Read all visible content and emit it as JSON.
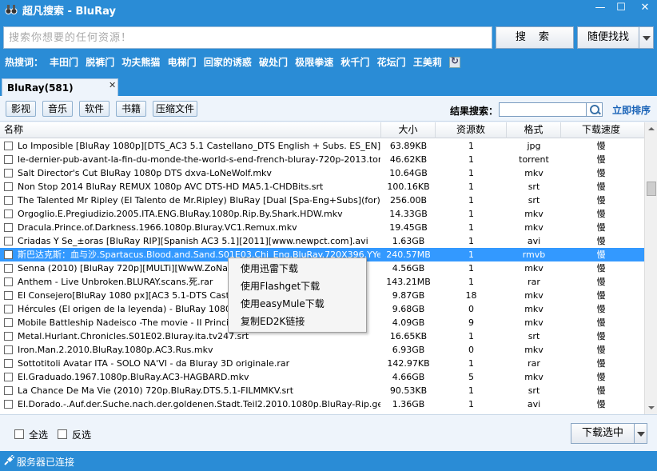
{
  "window": {
    "title": "超凡搜索 - BluRay"
  },
  "search": {
    "placeholder": "搜索你想要的任何资源！",
    "search_label": "搜 索",
    "random_label": "随便找找"
  },
  "hot": {
    "label": "热搜词：",
    "words": [
      "丰田门",
      "脱裤门",
      "功夫熊猫",
      "电梯门",
      "回家的诱惑",
      "破处门",
      "极限拳速",
      "秋千门",
      "花坛门",
      "王美莉"
    ]
  },
  "tab": {
    "label": "BluRay(581)",
    "close": "✕"
  },
  "categories": [
    "影视",
    "音乐",
    "软件",
    "书籍",
    "压缩文件"
  ],
  "filter": {
    "label": "结果搜索：",
    "sort_label": "立即排序"
  },
  "table": {
    "headers": {
      "name": "名称",
      "size": "大小",
      "sources": "资源数",
      "format": "格式",
      "speed": "下载速度"
    },
    "rows": [
      {
        "name": "Lo Imposible [BluRay 1080p][DTS_AC3 5.1 Castellano_DTS English + Subs. ES_EN][2013].m...",
        "size": "63.89KB",
        "sources": "1",
        "format": "jpg",
        "speed": "慢"
      },
      {
        "name": "le-dernier-pub-avant-la-fin-du-monde-the-world-s-end-french-bluray-720p-2013.torrent",
        "size": "46.62KB",
        "sources": "1",
        "format": "torrent",
        "speed": "慢"
      },
      {
        "name": "Salt Director's Cut BluRay 1080p DTS dxva-LoNeWolf.mkv",
        "size": "10.64GB",
        "sources": "1",
        "format": "mkv",
        "speed": "慢"
      },
      {
        "name": "Non Stop 2014 BluRay REMUX 1080p AVC DTS-HD MA5.1-CHDBits.srt",
        "size": "100.16KB",
        "sources": "1",
        "format": "srt",
        "speed": "慢"
      },
      {
        "name": "The Talented Mr Ripley (El Talento de Mr.Ripley) BluRay [Dual [Spa-Eng+Subs](for).srt",
        "size": "256.00B",
        "sources": "1",
        "format": "srt",
        "speed": "慢"
      },
      {
        "name": "Orgoglio.E.Pregiudizio.2005.ITA.ENG.BluRay.1080p.Rip.By.Shark.HDW.mkv",
        "size": "14.33GB",
        "sources": "1",
        "format": "mkv",
        "speed": "慢"
      },
      {
        "name": "Dracula.Prince.of.Darkness.1966.1080p.Bluray.VC1.Remux.mkv",
        "size": "19.45GB",
        "sources": "1",
        "format": "mkv",
        "speed": "慢"
      },
      {
        "name": "Criadas Y Se_±oras [BluRay RIP][Spanish AC3 5.1][2011][www.newpct.com].avi",
        "size": "1.63GB",
        "sources": "1",
        "format": "avi",
        "speed": "慢"
      },
      {
        "name": "斯巴达克斯：血与沙.Spartacus.Blood.and.Sand.S01E03.Chi_Eng.BluRay.720X396.YYeTs...",
        "size": "240.57MB",
        "sources": "1",
        "format": "rmvb",
        "speed": "慢"
      },
      {
        "name": "Senna (2010) [BluRay 720p][MULTi][WwW.ZoNaTe",
        "size": "4.56GB",
        "sources": "1",
        "format": "mkv",
        "speed": "慢"
      },
      {
        "name": "Anthem - Live Unbroken.BLURAY.scans.死.rar",
        "size": "143.21MB",
        "sources": "1",
        "format": "rar",
        "speed": "慢"
      },
      {
        "name": "El Consejero[BluRay 1080 px][AC3 5.1-DTS Castella",
        "size": "9.87GB",
        "sources": "18",
        "format": "mkv",
        "speed": "慢"
      },
      {
        "name": "Hércules (El origen de la leyenda) - BluRay 1080p.m",
        "size": "9.68GB",
        "sources": "0",
        "format": "mkv",
        "speed": "慢"
      },
      {
        "name": "Mobile Battleship Nadeisco -The movie - II Principe",
        "size": "4.09GB",
        "sources": "9",
        "format": "mkv",
        "speed": "慢"
      },
      {
        "name": "Metal.Hurlant.Chronicles.S01E02.Bluray.ita.tv247.srt",
        "size": "16.65KB",
        "sources": "1",
        "format": "srt",
        "speed": "慢"
      },
      {
        "name": "Iron.Man.2.2010.BluRay.1080p.AC3.Rus.mkv",
        "size": "6.93GB",
        "sources": "0",
        "format": "mkv",
        "speed": "慢"
      },
      {
        "name": "Sottotitoli Avatar ITA - SOLO NA'VI - da Bluray 3D originale.rar",
        "size": "142.97KB",
        "sources": "1",
        "format": "rar",
        "speed": "慢"
      },
      {
        "name": "El.Graduado.1967.1080p.BluRay.AC3-HAGBARD.mkv",
        "size": "4.66GB",
        "sources": "5",
        "format": "mkv",
        "speed": "慢"
      },
      {
        "name": "La Chance De Ma Vie (2010) 720p.BluRay.DTS.5.1-FILMMKV.srt",
        "size": "90.53KB",
        "sources": "1",
        "format": "srt",
        "speed": "慢"
      },
      {
        "name": "El.Dorado.-.Auf.der.Suche.nach.der.goldenen.Stadt.Teil2.2010.1080p.BluRay-Rip.german.AC...",
        "size": "1.36GB",
        "sources": "1",
        "format": "avi",
        "speed": "慢"
      }
    ]
  },
  "context_menu": [
    "使用迅雷下载",
    "使用Flashget下载",
    "使用easyMule下载",
    "复制ED2K链接"
  ],
  "bottom": {
    "select_all": "全选",
    "invert": "反选",
    "download_selected": "下载选中"
  },
  "status": {
    "text": "服务器已连接"
  }
}
